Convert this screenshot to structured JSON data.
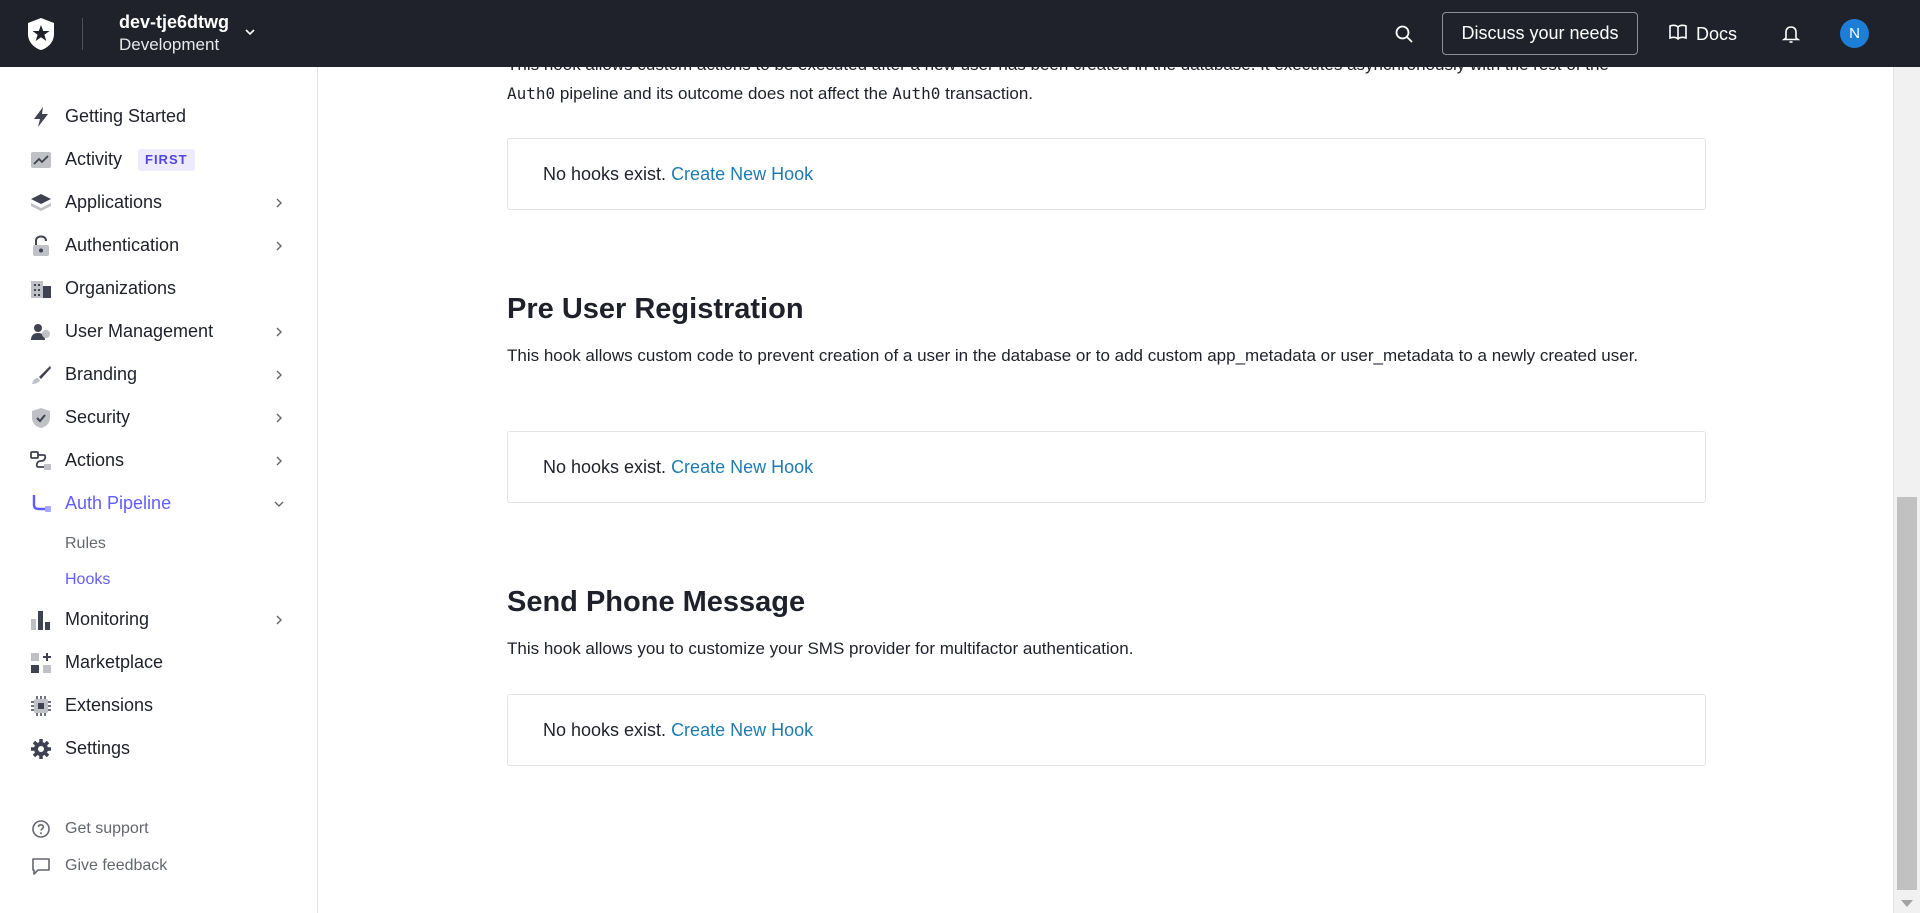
{
  "topbar": {
    "tenant_name": "dev-tje6dtwg",
    "tenant_env": "Development",
    "discuss_label": "Discuss your needs",
    "docs_label": "Docs",
    "avatar_initial": "N"
  },
  "sidebar": {
    "items": [
      {
        "label": "Getting Started",
        "icon": "bolt-icon"
      },
      {
        "label": "Activity",
        "icon": "activity-icon",
        "badge": "FIRST"
      },
      {
        "label": "Applications",
        "icon": "layers-icon"
      },
      {
        "label": "Authentication",
        "icon": "lock-icon"
      },
      {
        "label": "Organizations",
        "icon": "building-icon"
      },
      {
        "label": "User Management",
        "icon": "users-icon"
      },
      {
        "label": "Branding",
        "icon": "brush-icon"
      },
      {
        "label": "Security",
        "icon": "shield-icon"
      },
      {
        "label": "Actions",
        "icon": "flow-icon"
      },
      {
        "label": "Auth Pipeline",
        "icon": "pipeline-icon"
      },
      {
        "label": "Monitoring",
        "icon": "bar-chart-icon"
      },
      {
        "label": "Marketplace",
        "icon": "grid-plus-icon"
      },
      {
        "label": "Extensions",
        "icon": "chip-icon"
      },
      {
        "label": "Settings",
        "icon": "gear-icon"
      }
    ],
    "subitems": [
      "Rules",
      "Hooks"
    ],
    "footer": [
      {
        "label": "Get support",
        "icon": "help-circle-icon"
      },
      {
        "label": "Give feedback",
        "icon": "message-icon"
      }
    ]
  },
  "main": {
    "top_desc_line1": "This hook allows custom actions to be executed after a new user has been created in the database. It executes asynchronously with the rest of the",
    "top_desc_line2_a": "Auth0",
    "top_desc_line2_b": " pipeline and its outcome does not affect the ",
    "top_desc_line2_c": "Auth0",
    "top_desc_line2_d": " transaction.",
    "empty_text": "No hooks exist.",
    "create_link": "Create New Hook",
    "sections": [
      {
        "title": "Pre User Registration",
        "desc": "This hook allows custom code to prevent creation of a user in the database or to add custom app_metadata or user_metadata to a newly created user."
      },
      {
        "title": "Send Phone Message",
        "desc": "This hook allows you to customize your SMS provider for multifactor authentication."
      }
    ]
  },
  "colors": {
    "accent": "#635dff",
    "link": "#1f7bb0",
    "topbar": "#1f222a"
  }
}
